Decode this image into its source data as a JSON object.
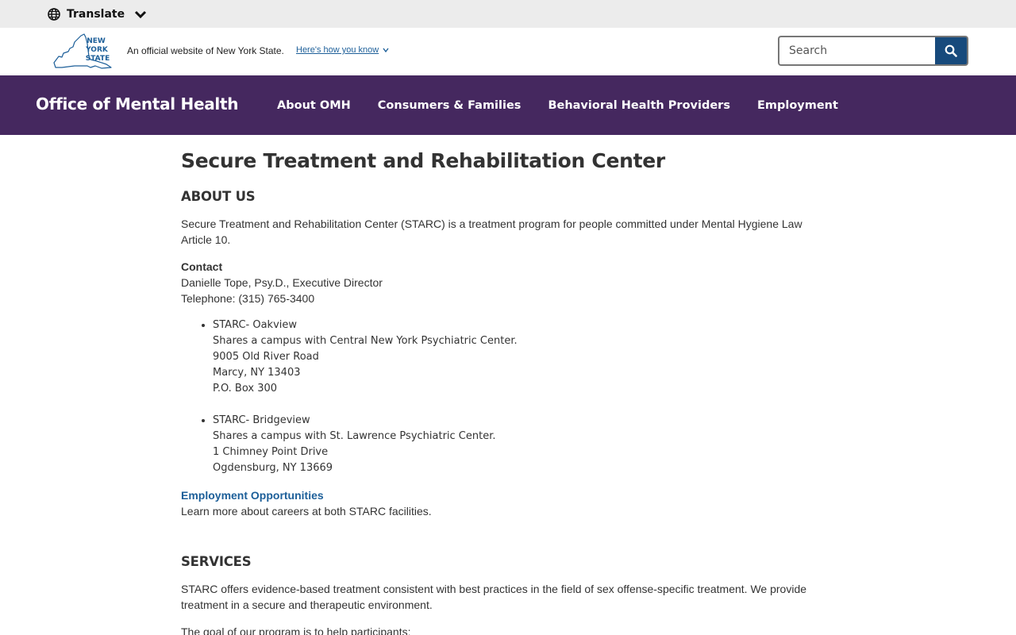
{
  "translate": {
    "label": "Translate",
    "icon": "globe-icon"
  },
  "official_banner": {
    "logo_lines": [
      "NEW",
      "YORK",
      "STATE"
    ],
    "text": "An official website of New York State.",
    "how_link": "Here's how you know"
  },
  "search": {
    "placeholder": "Search",
    "icon": "search-icon",
    "accent": "#174a7c"
  },
  "agency": {
    "title": "Office of Mental Health",
    "brand_color": "#45285f",
    "nav": [
      "About OMH",
      "Consumers & Families",
      "Behavioral Health Providers",
      "Employment"
    ]
  },
  "main": {
    "title": "Secure Treatment and Rehabilitation Center",
    "about_heading": "ABOUT US",
    "about_lines": [
      "Secure Treatment and Rehabilitation Center (STARC) is a treatment program for people committed under Mental Hygiene Law",
      "Article 10."
    ],
    "contact": {
      "label": "Contact",
      "name": "Danielle Tope, Psy.D., Executive Director",
      "phone": "Telephone: (315) 765-3400"
    },
    "locations": [
      {
        "name": "STARC- Oakview",
        "lines": [
          "Shares a campus with Central New York Psychiatric Center.",
          "9005 Old River Road",
          "Marcy, NY 13403",
          "P.O. Box 300"
        ]
      },
      {
        "name": "STARC- Bridgeview",
        "lines": [
          "Shares a campus with St. Lawrence Psychiatric Center.",
          "1 Chimney Point Drive",
          "Ogdensburg, NY 13669"
        ]
      }
    ],
    "employment": {
      "link": "Employment Opportunities",
      "text": "Learn more about careers at both STARC facilities.",
      "link_color": "#1d5f99"
    },
    "services_heading": "SERVICES",
    "services_lines": [
      "STARC offers evidence-based treatment consistent with best practices in the field of sex offense-specific treatment. We provide",
      "treatment in a secure and therapeutic environment."
    ],
    "goal_text": "The goal of our program is to help participants:"
  }
}
